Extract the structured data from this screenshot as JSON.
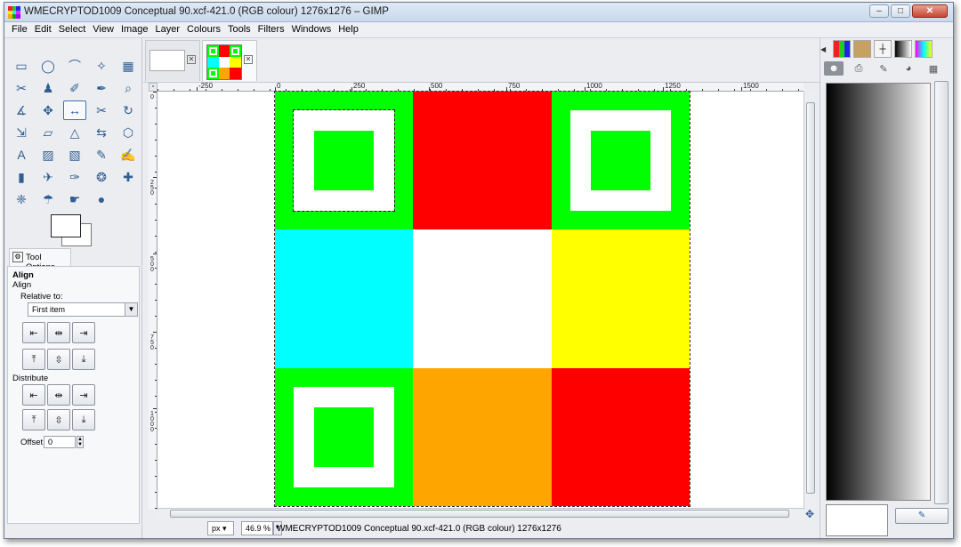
{
  "window": {
    "title": "WMECRYPTOD1009 Conceptual 90.xcf-421.0 (RGB colour) 1276x1276 – GIMP",
    "minimize": "–",
    "maximize": "□",
    "close": "✕"
  },
  "menubar": {
    "items": [
      {
        "label": "File"
      },
      {
        "label": "Edit"
      },
      {
        "label": "Select"
      },
      {
        "label": "View"
      },
      {
        "label": "Image"
      },
      {
        "label": "Layer"
      },
      {
        "label": "Colours"
      },
      {
        "label": "Tools"
      },
      {
        "label": "Filters"
      },
      {
        "label": "Windows"
      },
      {
        "label": "Help"
      }
    ]
  },
  "toolbox": {
    "tools": [
      {
        "name": "rect-select-tool-icon",
        "glyph": "▭"
      },
      {
        "name": "ellipse-select-tool-icon",
        "glyph": "◯"
      },
      {
        "name": "free-select-tool-icon",
        "glyph": "⌒"
      },
      {
        "name": "fuzzy-select-tool-icon",
        "glyph": "✧"
      },
      {
        "name": "color-select-tool-icon",
        "glyph": "▦"
      },
      {
        "name": "scissors-tool-icon",
        "glyph": "✂"
      },
      {
        "name": "foreground-select-tool-icon",
        "glyph": "♟"
      },
      {
        "name": "paths-tool-icon",
        "glyph": "✐"
      },
      {
        "name": "color-picker-tool-icon",
        "glyph": "✒"
      },
      {
        "name": "zoom-tool-icon",
        "glyph": "⌕"
      },
      {
        "name": "measure-tool-icon",
        "glyph": "∡"
      },
      {
        "name": "move-tool-icon",
        "glyph": "✥"
      },
      {
        "name": "align-tool-icon",
        "glyph": "↔"
      },
      {
        "name": "crop-tool-icon",
        "glyph": "✂"
      },
      {
        "name": "rotate-tool-icon",
        "glyph": "↻"
      },
      {
        "name": "scale-tool-icon",
        "glyph": "⇲"
      },
      {
        "name": "shear-tool-icon",
        "glyph": "▱"
      },
      {
        "name": "perspective-tool-icon",
        "glyph": "△"
      },
      {
        "name": "flip-tool-icon",
        "glyph": "⇆"
      },
      {
        "name": "cage-tool-icon",
        "glyph": "⬡"
      },
      {
        "name": "text-tool-icon",
        "glyph": "A"
      },
      {
        "name": "bucket-fill-tool-icon",
        "glyph": "▨"
      },
      {
        "name": "blend-tool-icon",
        "glyph": "▧"
      },
      {
        "name": "pencil-tool-icon",
        "glyph": "✎"
      },
      {
        "name": "paintbrush-tool-icon",
        "glyph": "✍"
      },
      {
        "name": "eraser-tool-icon",
        "glyph": "▮"
      },
      {
        "name": "airbrush-tool-icon",
        "glyph": "✈"
      },
      {
        "name": "ink-tool-icon",
        "glyph": "✑"
      },
      {
        "name": "clone-tool-icon",
        "glyph": "❂"
      },
      {
        "name": "heal-tool-icon",
        "glyph": "✚"
      },
      {
        "name": "perspective-clone-tool-icon",
        "glyph": "❈"
      },
      {
        "name": "blur-tool-icon",
        "glyph": "☂"
      },
      {
        "name": "smudge-tool-icon",
        "glyph": "☛"
      },
      {
        "name": "dodge-burn-tool-icon",
        "glyph": "●"
      }
    ],
    "active_tool": "align-tool-icon"
  },
  "tool_options": {
    "tab_label": "Tool Options",
    "title": "Align",
    "section": "Align",
    "relative_to_label": "Relative to:",
    "relative_to_value": "First item",
    "distribute_label": "Distribute",
    "offset_label": "Offset:",
    "offset_value": "0"
  },
  "image_tabs": [
    {
      "name": "blank-image-tab"
    },
    {
      "name": "grid-image-tab"
    }
  ],
  "ruler": {
    "h_labels": [
      "-250",
      "0",
      "250",
      "500",
      "750",
      "1000",
      "1250",
      "1500"
    ],
    "v_labels": [
      "0",
      "250",
      "500",
      "750",
      "1000"
    ]
  },
  "image_grid": {
    "colors": [
      "#00ff00",
      "#ff0000",
      "#00ff00",
      "#00ffff",
      "#ffffff",
      "#ffff00",
      "#00ff00",
      "#ffa500",
      "#ff0000"
    ],
    "ring_cells": [
      0,
      2,
      6
    ],
    "ring_color": "#ffffff",
    "inner_color": "#00ff00"
  },
  "statusbar": {
    "unit": "px",
    "zoom": "46.9 %",
    "text": "WMECRYPTOD1009 Conceptual 90.xcf-421.0 (RGB colour) 1276x1276"
  }
}
